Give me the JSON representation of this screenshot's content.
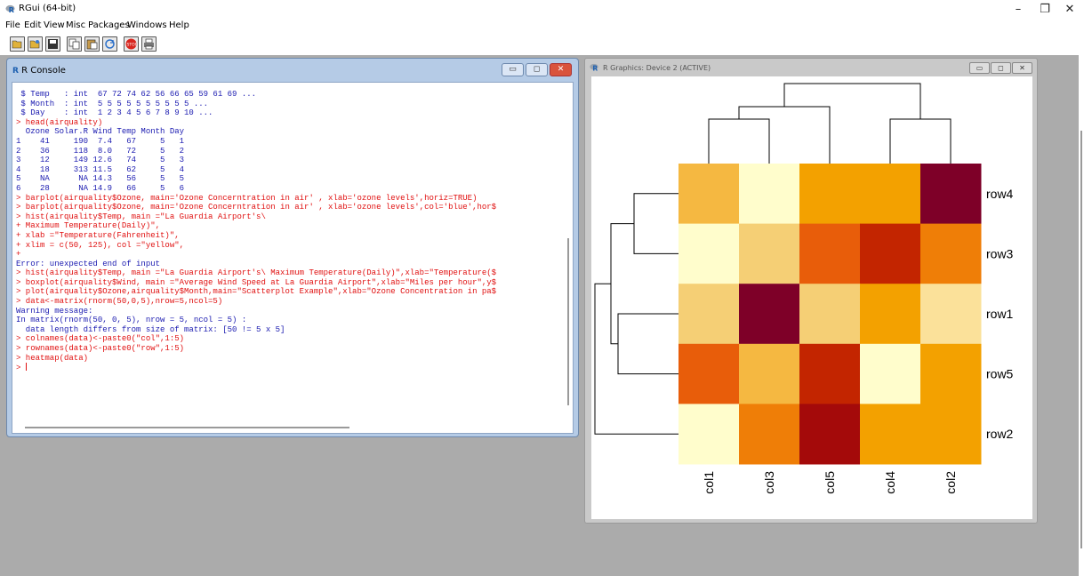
{
  "app": {
    "title": "RGui (64-bit)"
  },
  "menu": [
    "File",
    "Edit",
    "View",
    "Misc",
    "Packages",
    "Windows",
    "Help"
  ],
  "console": {
    "title": "R Console",
    "lines": [
      {
        "t": " $ Temp   : int  67 72 74 62 56 66 65 59 61 69 ...",
        "c": "out"
      },
      {
        "t": " $ Month  : int  5 5 5 5 5 5 5 5 5 5 ...",
        "c": "out"
      },
      {
        "t": " $ Day    : int  1 2 3 4 5 6 7 8 9 10 ...",
        "c": "out"
      },
      {
        "t": "> head(airquality)",
        "c": "cmd"
      },
      {
        "t": "  Ozone Solar.R Wind Temp Month Day",
        "c": "out"
      },
      {
        "t": "1    41     190  7.4   67     5   1",
        "c": "out"
      },
      {
        "t": "2    36     118  8.0   72     5   2",
        "c": "out"
      },
      {
        "t": "3    12     149 12.6   74     5   3",
        "c": "out"
      },
      {
        "t": "4    18     313 11.5   62     5   4",
        "c": "out"
      },
      {
        "t": "5    NA      NA 14.3   56     5   5",
        "c": "out"
      },
      {
        "t": "6    28      NA 14.9   66     5   6",
        "c": "out"
      },
      {
        "t": "> barplot(airquality$Ozone, main='Ozone Concerntration in air' , xlab='ozone levels',horiz=TRUE)",
        "c": "cmd"
      },
      {
        "t": "> barplot(airquality$Ozone, main='Ozone Concerntration in air' , xlab='ozone levels',col='blue',hor$",
        "c": "cmd"
      },
      {
        "t": "> hist(airquality$Temp, main =\"La Guardia Airport's\\",
        "c": "cmd"
      },
      {
        "t": "+ Maximum Temperature(Daily)\",",
        "c": "cmd"
      },
      {
        "t": "+ xlab =\"Temperature(Fahrenheit)\",",
        "c": "cmd"
      },
      {
        "t": "+ xlim = c(50, 125), col =\"yellow\",",
        "c": "cmd"
      },
      {
        "t": "+",
        "c": "cmd"
      },
      {
        "t": "Error: unexpected end of input",
        "c": "out"
      },
      {
        "t": "> hist(airquality$Temp, main =\"La Guardia Airport's\\ Maximum Temperature(Daily)\",xlab=\"Temperature($",
        "c": "cmd"
      },
      {
        "t": "> boxplot(airquality$Wind, main =\"Average Wind Speed at La Guardia Airport\",xlab=\"Miles per hour\",y$",
        "c": "cmd"
      },
      {
        "t": "> plot(airquality$Ozone,airquality$Month,main=\"Scatterplot Example\",xlab=\"Ozone Concentration in pa$",
        "c": "cmd"
      },
      {
        "t": "> data<-matrix(rnorm(50,0,5),nrow=5,ncol=5)",
        "c": "cmd"
      },
      {
        "t": "Warning message:",
        "c": "out"
      },
      {
        "t": "In matrix(rnorm(50, 0, 5), nrow = 5, ncol = 5) :",
        "c": "out"
      },
      {
        "t": "  data length differs from size of matrix: [50 != 5 x 5]",
        "c": "out"
      },
      {
        "t": "> colnames(data)<-paste0(\"col\",1:5)",
        "c": "cmd"
      },
      {
        "t": "> rownames(data)<-paste0(\"row\",1:5)",
        "c": "cmd"
      },
      {
        "t": "> heatmap(data)",
        "c": "cmd"
      }
    ],
    "prompt": "> "
  },
  "graphics": {
    "title": "R Graphics: Device 2 (ACTIVE)"
  },
  "chart_data": {
    "type": "heatmap",
    "title": "",
    "rows": [
      "row4",
      "row3",
      "row1",
      "row5",
      "row2"
    ],
    "columns": [
      "col1",
      "col3",
      "col5",
      "col4",
      "col2"
    ],
    "colors": [
      [
        "#f5b841",
        "#fffdcc",
        "#f3a100",
        "#f3a100",
        "#7e0028"
      ],
      [
        "#fffdcc",
        "#f5cf75",
        "#e85d0a",
        "#c32500",
        "#ef7e07"
      ],
      [
        "#f5cf75",
        "#7e0028",
        "#f5cf75",
        "#f3a100",
        "#fbe19a"
      ],
      [
        "#e85d0a",
        "#f5b841",
        "#c32500",
        "#fffdcc",
        "#f3a100"
      ],
      [
        "#fffdcc",
        "#ef7e07",
        "#a40a0a",
        "#f3a100",
        "#f3a100"
      ]
    ],
    "row_dendrogram": true,
    "column_dendrogram": true
  }
}
